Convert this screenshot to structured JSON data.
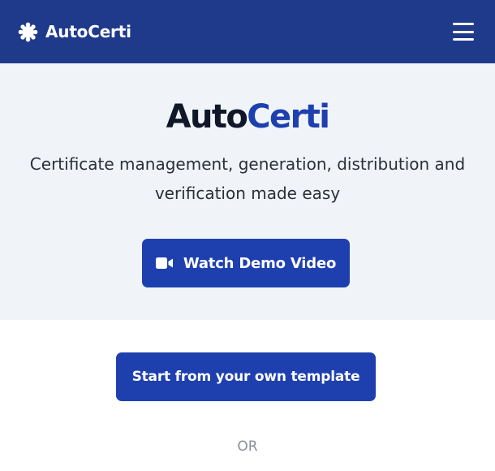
{
  "header": {
    "brand_name": "AutoCerti",
    "logo_icon": "gear-badge-icon",
    "menu_icon": "hamburger-menu-icon",
    "background_color": "#1f3a8a"
  },
  "hero": {
    "title_part1": "Auto",
    "title_part2": "Certi",
    "tagline": "Certificate management, generation, distribution and verification made easy",
    "demo_button": {
      "icon": "video-camera-icon",
      "label": "Watch Demo Video"
    },
    "accent_color": "#1e40af",
    "background_color": "#f0f4f9"
  },
  "main": {
    "template_button_label": "Start from your own template",
    "or_divider": "OR"
  }
}
